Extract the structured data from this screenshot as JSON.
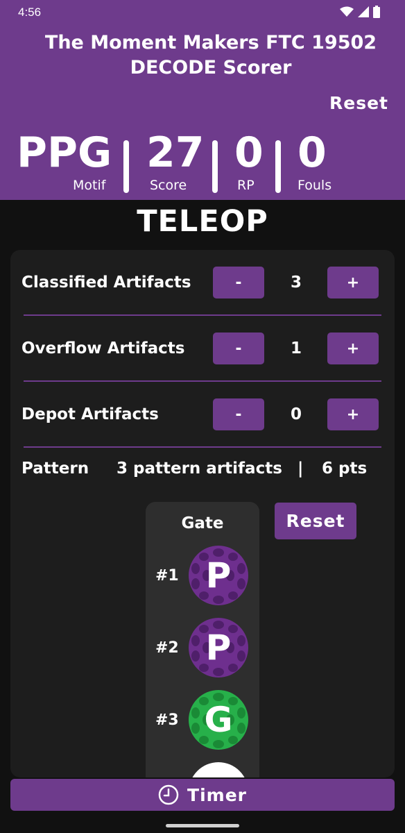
{
  "status": {
    "time": "4:56"
  },
  "app": {
    "title_line1": "The Moment Makers FTC 19502",
    "title_line2": "DECODE Scorer",
    "reset_label": "Reset"
  },
  "stats": {
    "motif": {
      "value": "PPG",
      "label": "Motif"
    },
    "score": {
      "value": "27",
      "label": "Score"
    },
    "rp": {
      "value": "0",
      "label": "RP"
    },
    "fouls": {
      "value": "0",
      "label": "Fouls"
    }
  },
  "section": {
    "title": "TELEOP"
  },
  "counters": [
    {
      "label": "Classified Artifacts",
      "minus": "-",
      "value": "3",
      "plus": "+"
    },
    {
      "label": "Overflow Artifacts",
      "minus": "-",
      "value": "1",
      "plus": "+"
    },
    {
      "label": "Depot Artifacts",
      "minus": "-",
      "value": "0",
      "plus": "+"
    }
  ],
  "pattern": {
    "label": "Pattern",
    "summary": "3 pattern artifacts",
    "separator": "|",
    "points": "6 pts",
    "reset_label": "Reset"
  },
  "gate": {
    "title": "Gate",
    "slots": [
      {
        "number": "#1",
        "letter": "P",
        "color": "#6e2f8e"
      },
      {
        "number": "#2",
        "letter": "P",
        "color": "#6e2f8e"
      },
      {
        "number": "#3",
        "letter": "G",
        "color": "#27b04a"
      }
    ]
  },
  "timer": {
    "label": "Timer"
  },
  "colors": {
    "accent": "#6e3b8c",
    "background": "#111111",
    "card": "#1d1d1d",
    "purple_ball": "#6e2f8e",
    "green_ball": "#27b04a"
  },
  "icons": {
    "wifi": "wifi-icon",
    "signal": "signal-icon",
    "battery": "battery-icon",
    "clock": "clock-icon"
  }
}
